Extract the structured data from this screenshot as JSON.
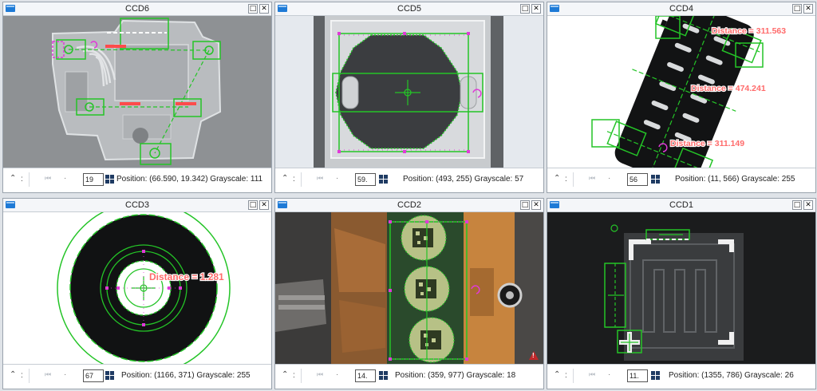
{
  "colors": {
    "accent_green": "#24c427",
    "magenta": "#e03ad8",
    "distance_label": "#ff6b6b",
    "window_icon": "#1e7ad6"
  },
  "icons": {
    "window": "window-icon",
    "maximize": "maximize-icon",
    "close": "close-icon",
    "expand": "chevron-double-up-icon",
    "nav": "skip-first-icon",
    "grid": "grid-icon",
    "warning": "warning-icon"
  },
  "panels": [
    {
      "title": "CCD6",
      "maximize_glyph": "□",
      "close_glyph": "✕",
      "expand_glyph": "⌃",
      "colon": ":",
      "nav_glyph": "⏮",
      "dot": "·",
      "zoom": "19",
      "status": "Position: (66.590, 19.342) Grayscale: 111",
      "distance_labels": []
    },
    {
      "title": "CCD5",
      "maximize_glyph": "□",
      "close_glyph": "✕",
      "expand_glyph": "⌃",
      "colon": ":",
      "nav_glyph": "⏮",
      "dot": "·",
      "zoom": "59.",
      "status": "Position: (493, 255) Grayscale: 57",
      "distance_labels": []
    },
    {
      "title": "CCD4",
      "maximize_glyph": "□",
      "close_glyph": "✕",
      "expand_glyph": "⌃",
      "colon": ":",
      "nav_glyph": "⏮",
      "dot": "·",
      "zoom": "56",
      "status": "Position: (11, 566) Grayscale: 255",
      "distance_labels": [
        "Distance = 311.563",
        "Distance = 474.241",
        "Distance = 311.149"
      ]
    },
    {
      "title": "CCD3",
      "maximize_glyph": "□",
      "close_glyph": "✕",
      "expand_glyph": "⌃",
      "colon": ":",
      "nav_glyph": "⏮",
      "dot": "·",
      "zoom": "67",
      "status": "Position: (1166, 371) Grayscale: 255",
      "distance_labels": [
        "Distance = 1.281"
      ]
    },
    {
      "title": "CCD2",
      "maximize_glyph": "□",
      "close_glyph": "✕",
      "expand_glyph": "⌃",
      "colon": ":",
      "nav_glyph": "⏮",
      "dot": "·",
      "zoom": "14.",
      "status": "Position: (359, 977) Grayscale: 18",
      "distance_labels": []
    },
    {
      "title": "CCD1",
      "maximize_glyph": "□",
      "close_glyph": "✕",
      "expand_glyph": "⌃",
      "colon": ":",
      "nav_glyph": "⏮",
      "dot": "·",
      "zoom": "11.",
      "status": "Position: (1355, 786) Grayscale: 26",
      "distance_labels": []
    }
  ]
}
